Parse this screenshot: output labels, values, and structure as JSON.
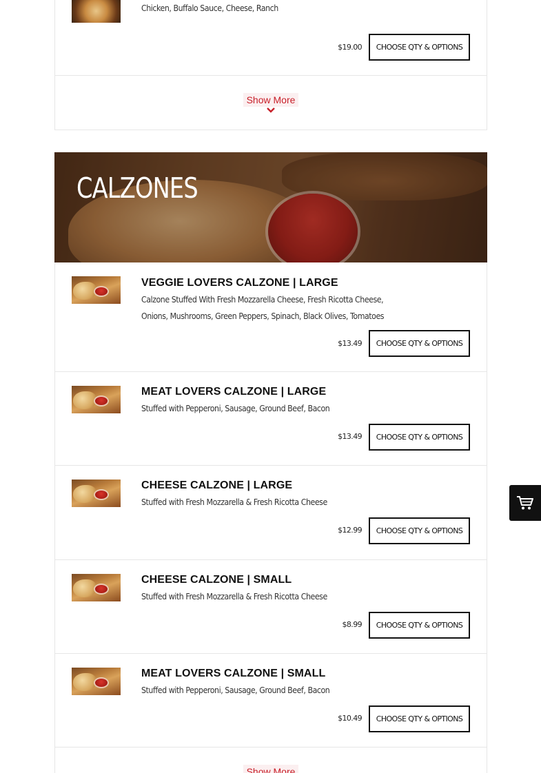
{
  "previous_section": {
    "last_item": {
      "description": "Chicken, Buffalo Sauce, Cheese, Ranch",
      "price": "$19.00",
      "button_label": "CHOOSE QTY & OPTIONS"
    },
    "show_more_label": "Show More"
  },
  "section": {
    "heading": "CALZONES",
    "items": [
      {
        "title": "VEGGIE LOVERS CALZONE | LARGE",
        "description_line1": "Calzone Stuffed With Fresh Mozzarella Cheese, Fresh Ricotta Cheese,",
        "description_line2": "Onions, Mushrooms, Green Peppers, Spinach, Black Olives, Tomatoes",
        "price": "$13.49",
        "button_label": "CHOOSE QTY & OPTIONS"
      },
      {
        "title": "MEAT LOVERS CALZONE | LARGE",
        "description_line1": "Stuffed with Pepperoni, Sausage, Ground Beef, Bacon",
        "price": "$13.49",
        "button_label": "CHOOSE QTY & OPTIONS"
      },
      {
        "title": "CHEESE CALZONE | LARGE",
        "description_line1": "Stuffed with Fresh Mozzarella & Fresh Ricotta Cheese",
        "price": "$12.99",
        "button_label": "CHOOSE QTY & OPTIONS"
      },
      {
        "title": "CHEESE CALZONE | SMALL",
        "description_line1": "Stuffed with Fresh Mozzarella & Fresh Ricotta Cheese",
        "price": "$8.99",
        "button_label": "CHOOSE QTY & OPTIONS"
      },
      {
        "title": "MEAT LOVERS CALZONE | SMALL",
        "description_line1": "Stuffed with Pepperoni, Sausage, Ground Beef, Bacon",
        "price": "$10.49",
        "button_label": "CHOOSE QTY & OPTIONS"
      }
    ],
    "show_more_label": "Show More"
  },
  "floating_cart": {
    "icon": "shopping-cart-icon"
  },
  "colors": {
    "accent": "#c8202a",
    "button_border": "#111111",
    "cart_bg": "#111111"
  }
}
